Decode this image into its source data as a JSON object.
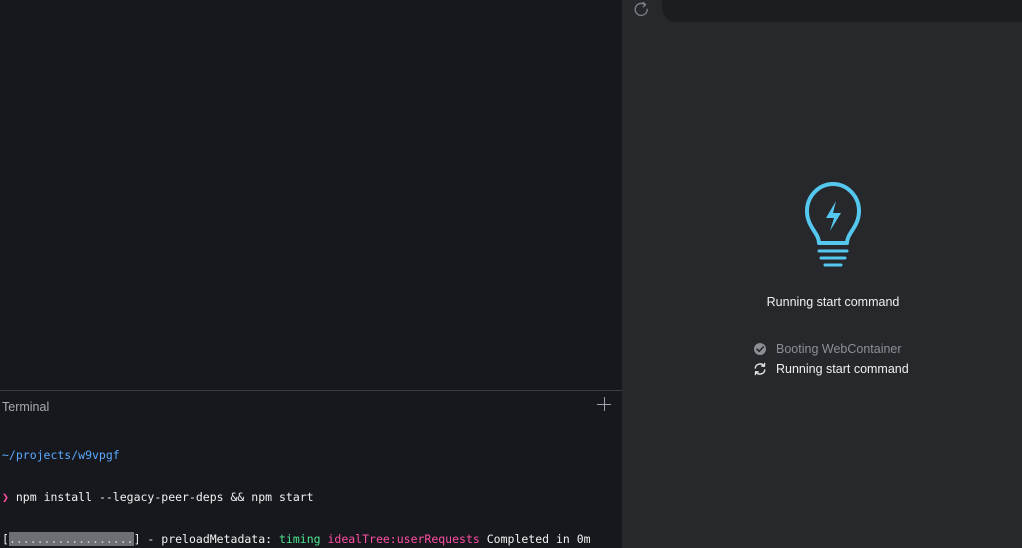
{
  "terminal": {
    "title": "Terminal",
    "add_icon": "plus-icon",
    "cwd": "~/projects/w9vpgf",
    "prompt_symbol": "❯",
    "command": "npm install --legacy-peer-deps && npm start",
    "progress_open": "[",
    "progress_bar": "..................",
    "progress_close": "]",
    "progress_sep": " - ",
    "stage": "preloadMetadata:",
    "timing_word": "timing",
    "timing_target": "idealTree:userRequests",
    "timing_result": "Completed in 0m"
  },
  "preview": {
    "reload_icon": "reload-icon",
    "bulb_icon": "lightbulb-bolt-icon",
    "accent_color": "#55c8ef",
    "status_text": "Running start command",
    "steps": [
      {
        "label": "Booting WebContainer",
        "state": "done",
        "icon": "check-circle-icon"
      },
      {
        "label": "Running start command",
        "state": "active",
        "icon": "refresh-icon"
      }
    ]
  }
}
